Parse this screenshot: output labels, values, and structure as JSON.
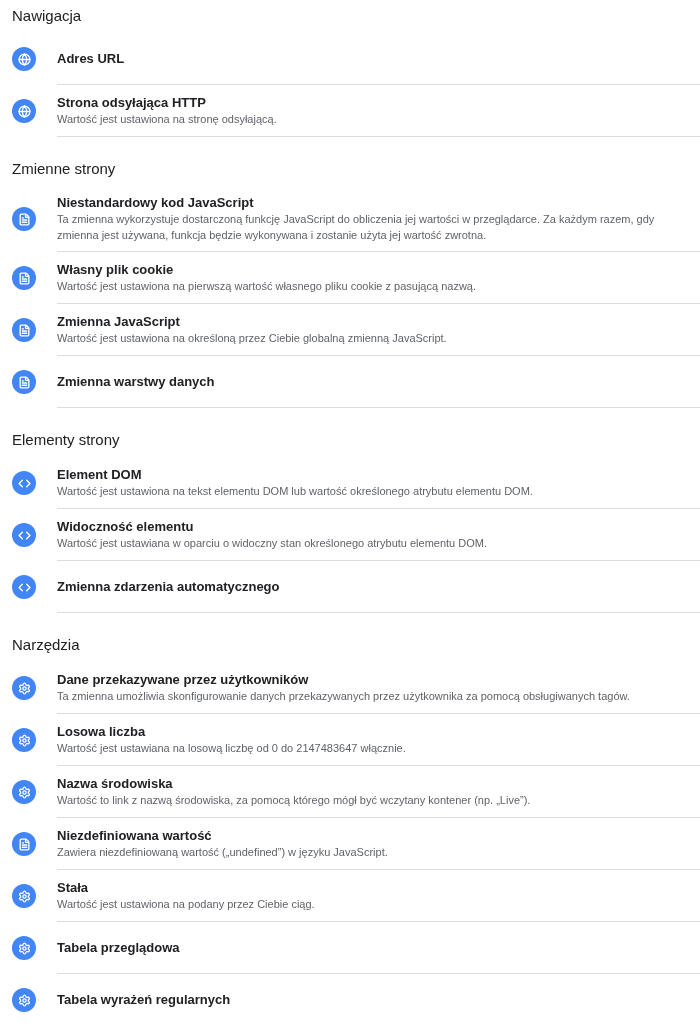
{
  "sections": [
    {
      "title": "Nawigacja",
      "items": [
        {
          "kind": "globe",
          "name": "Adres URL"
        },
        {
          "kind": "globe",
          "name": "Strona odsyłająca HTTP",
          "description": "Wartość jest ustawiona na stronę odsyłającą."
        }
      ]
    },
    {
      "title": "Zmienne strony",
      "items": [
        {
          "kind": "document",
          "name": "Niestandardowy kod JavaScript",
          "description": "Ta zmienna wykorzystuje dostarczoną funkcję JavaScript do obliczenia jej wartości w przeglądarce. Za każdym razem, gdy zmienna jest używana, funkcja będzie wykonywana i zostanie użyta jej wartość zwrotna."
        },
        {
          "kind": "document",
          "name": "Własny plik cookie",
          "description": "Wartość jest ustawiona na pierwszą wartość własnego pliku cookie z pasującą nazwą."
        },
        {
          "kind": "document",
          "name": "Zmienna JavaScript",
          "description": "Wartość jest ustawiona na określoną przez Ciebie globalną zmienną JavaScript."
        },
        {
          "kind": "document",
          "name": "Zmienna warstwy danych"
        }
      ]
    },
    {
      "title": "Elementy strony",
      "items": [
        {
          "kind": "code",
          "name": "Element DOM",
          "description": "Wartość jest ustawiona na tekst elementu DOM lub wartość określonego atrybutu elementu DOM."
        },
        {
          "kind": "code",
          "name": "Widoczność elementu",
          "description": "Wartość jest ustawiana w oparciu o widoczny stan określonego atrybutu elementu DOM."
        },
        {
          "kind": "code",
          "name": "Zmienna zdarzenia automatycznego"
        }
      ]
    },
    {
      "title": "Narzędzia",
      "items": [
        {
          "kind": "gear",
          "name": "Dane przekazywane przez użytkowników",
          "description": "Ta zmienna umożliwia skonfigurowanie danych przekazywanych przez użytkownika za pomocą obsługiwanych tagów."
        },
        {
          "kind": "gear",
          "name": "Losowa liczba",
          "description": "Wartość jest ustawiana na losową liczbę od 0 do 2147483647 włącznie."
        },
        {
          "kind": "gear",
          "name": "Nazwa środowiska",
          "description": "Wartość to link z nazwą środowiska, za pomocą którego mógł być wczytany kontener (np. „Live”)."
        },
        {
          "kind": "document",
          "name": "Niezdefiniowana wartość",
          "description": "Zawiera niezdefiniowaną wartość („undefined”) w języku JavaScript."
        },
        {
          "kind": "gear",
          "name": "Stała",
          "description": "Wartość jest ustawiona na podany przez Ciebie ciąg."
        },
        {
          "kind": "gear",
          "name": "Tabela przeglądowa"
        },
        {
          "kind": "gear",
          "name": "Tabela wyrażeń regularnych"
        }
      ]
    }
  ]
}
